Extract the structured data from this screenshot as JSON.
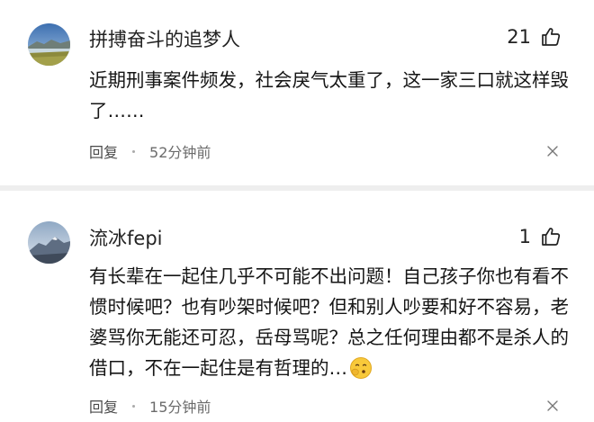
{
  "comments": [
    {
      "username": "拼搏奋斗的追梦人",
      "likes": "21",
      "text": "近期刑事案件频发，社会戾气太重了，这一家三口就这样毁了……",
      "reply_label": "回复",
      "time": "52分钟前",
      "avatar_icon": "landscape-avatar-icon"
    },
    {
      "username": "流冰fepi",
      "likes": "1",
      "text": "有长辈在一起住几乎不可能不出问题！自己孩子你也有看不惯时候吧？也有吵架时候吧？但和别人吵要和好不容易，老婆骂你无能还可忍，岳母骂呢？总之任何理由都不是杀人的借口，不在一起住是有哲理的…",
      "reply_label": "回复",
      "time": "15分钟前",
      "avatar_icon": "mountain-avatar-icon",
      "emoji_icon": "pondering-face-emoji"
    }
  ],
  "colors": {
    "divider": "#eeeeee",
    "meta_text": "#6b6b6b"
  }
}
